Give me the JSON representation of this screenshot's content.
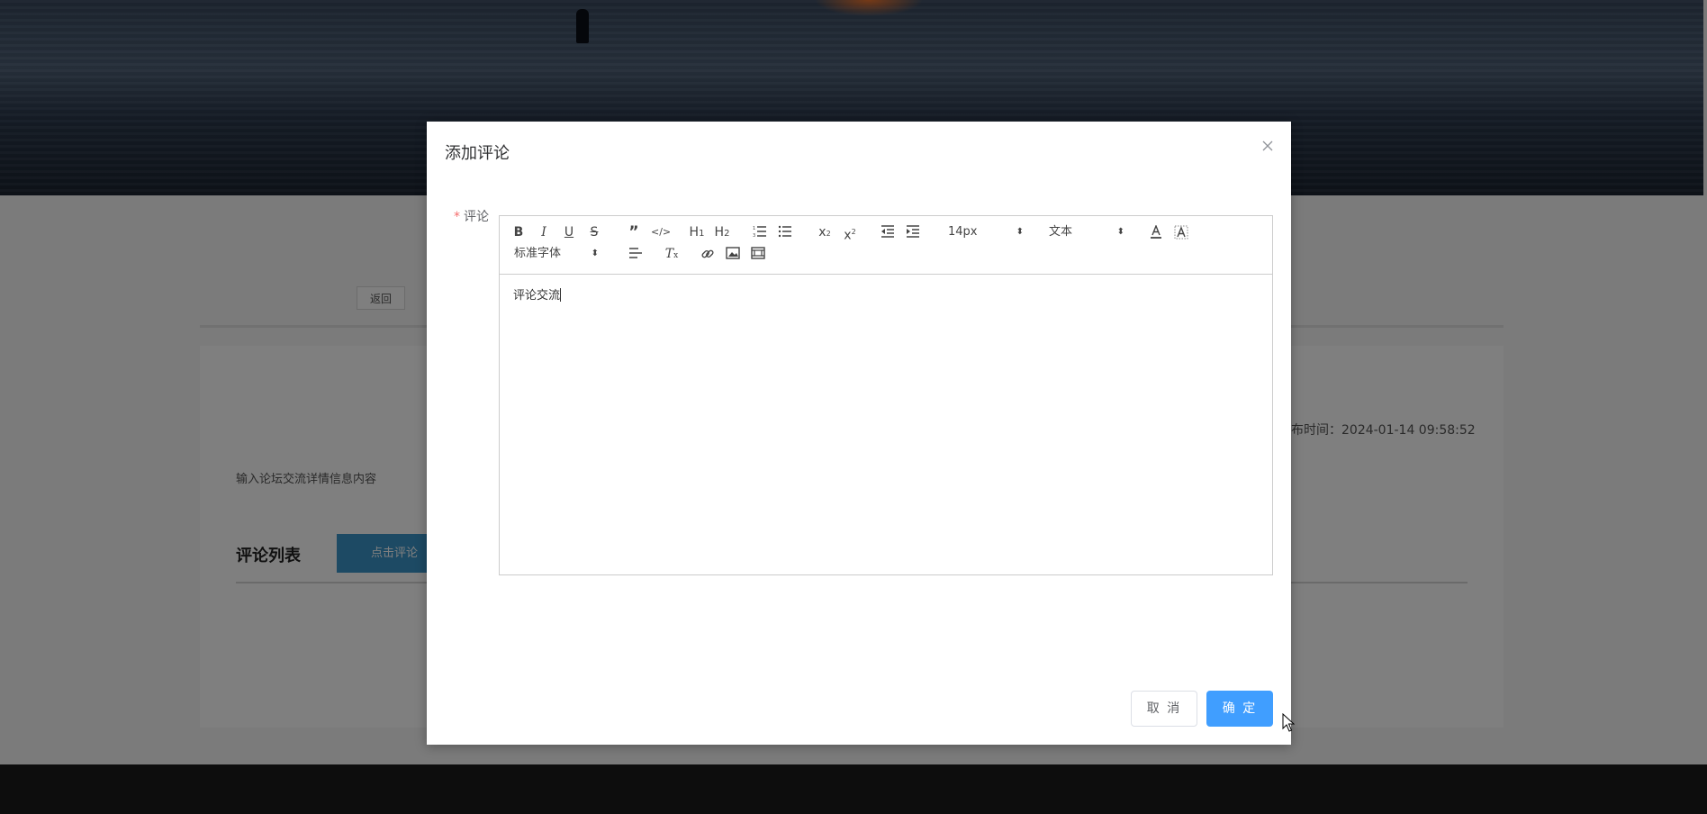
{
  "page": {
    "back_label": "返回",
    "publish_time": "布时间：2024-01-14 09:58:52",
    "content_text": "输入论坛交流详情信息内容",
    "comments_title": "评论列表",
    "comment_button": "点击评论"
  },
  "dialog": {
    "title": "添加评论",
    "field_label": "评论",
    "required_mark": "*",
    "editor_text": "评论交流",
    "cancel_label": "取 消",
    "confirm_label": "确 定"
  },
  "toolbar": {
    "font_size": "14px",
    "header": "文本",
    "font_family": "标准字体",
    "tools": [
      "bold-icon",
      "italic-icon",
      "underline-icon",
      "strike-icon",
      "blockquote-icon",
      "code-block-icon",
      "h1-icon",
      "h2-icon",
      "ordered-list-icon",
      "bullet-list-icon",
      "subscript-icon",
      "superscript-icon",
      "outdent-icon",
      "indent-icon",
      "font-color-icon",
      "background-color-icon",
      "align-icon",
      "clean-icon",
      "link-icon",
      "image-icon",
      "video-icon"
    ]
  },
  "colors": {
    "primary": "#409eff",
    "comment_button": "#3a95c8",
    "required": "#f56c6c",
    "overlay": "rgba(0,0,0,0.5)"
  }
}
